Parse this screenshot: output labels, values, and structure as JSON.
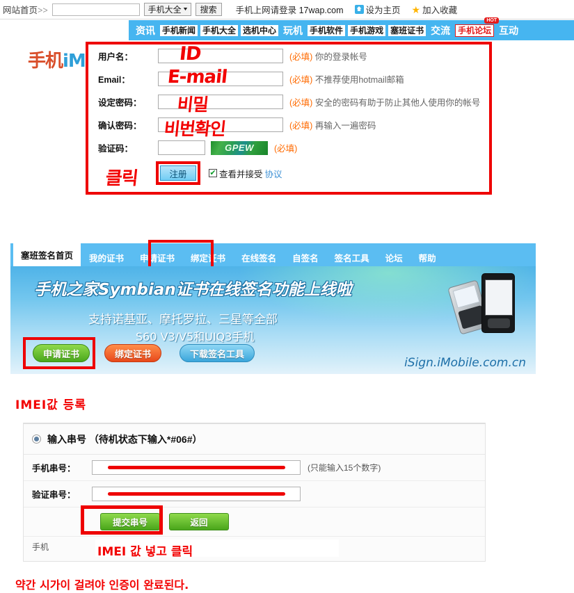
{
  "topbar": {
    "home_link": "网站首页",
    "home_gt": ">>",
    "search_value": "",
    "search_placeholder": "",
    "category_label": "手机大全",
    "search_button": "搜索",
    "tip": "手机上网请登录",
    "tip_domain": "17wap.com",
    "set_home": "设为主页",
    "add_fav": "加入收藏"
  },
  "nav": {
    "logo_text_red": "手机",
    "logo_text_blue": "iMobile",
    "groups": [
      {
        "head": "资讯",
        "chips": [
          "手机新闻",
          "手机大全",
          "选机中心"
        ]
      },
      {
        "head": "玩机",
        "chips": [
          "手机软件",
          "手机游戏",
          "塞班证书"
        ]
      },
      {
        "head": "交流",
        "chips": [
          "手机论坛"
        ]
      },
      {
        "head": "互动",
        "chips": []
      }
    ],
    "hot_badge": "HOT"
  },
  "register_form": {
    "rows": [
      {
        "label": "用户名：",
        "value": "",
        "req": "(必填)",
        "hint": "你的登录帐号",
        "hand": "ID"
      },
      {
        "label": "Email：",
        "value": "",
        "req": "(必填)",
        "hint": "不推荐使用hotmail邮箱",
        "hand": "E-mail"
      },
      {
        "label": "设定密码：",
        "value": "",
        "req": "(必填)",
        "hint": "安全的密码有助于防止其他人使用你的帐号",
        "hand": "비밀"
      },
      {
        "label": "确认密码：",
        "value": "",
        "req": "(必填)",
        "hint": "再输入一遍密码",
        "hand": "비번확인"
      }
    ],
    "captcha_label": "验证码：",
    "captcha_value": "",
    "captcha_text": "GPEW",
    "captcha_req": "(必填)",
    "submit_label": "注册",
    "agree_text": "查看并接受",
    "agree_link": "协议",
    "hand_click": "클릭"
  },
  "sign_page": {
    "tabs": [
      {
        "label": "塞班签名首页",
        "active": true
      },
      {
        "label": "我的证书",
        "active": false
      },
      {
        "label": "申请证书",
        "active": false
      },
      {
        "label": "绑定证书",
        "active": false
      },
      {
        "label": "在线签名",
        "active": false
      },
      {
        "label": "自签名",
        "active": false
      },
      {
        "label": "签名工具",
        "active": false
      },
      {
        "label": "论坛",
        "active": false
      },
      {
        "label": "帮助",
        "active": false
      }
    ],
    "banner": {
      "title": "手机之家Symbian证书在线签名功能上线啦",
      "line2": "支持诺基亚、摩托罗拉、三星等全部",
      "line3": "S60  V3/V5和UIQ3手机",
      "pills": [
        "申请证书",
        "绑定证书",
        "下载签名工具"
      ],
      "site": "iSign.iMobile.com.cn"
    }
  },
  "imei_section": {
    "title_hand": "IMEI값 등록",
    "radio_label": "输入串号  （待机状态下输入*#06#）",
    "rows": [
      {
        "label": "手机串号：",
        "value": "",
        "note": "(只能输入15个数字)"
      },
      {
        "label": "验证串号：",
        "value": "",
        "note": ""
      }
    ],
    "submit_button": "提交串号",
    "back_button": "返回",
    "footer_note": "手机",
    "hand_note": "IMEI 값 넣고 클릭"
  },
  "bottom_note": "약간 시가이 걸려야 인증이 완료된다.",
  "colors": {
    "annotation_red": "#f20000",
    "nav_blue": "#46b5f0",
    "tab_blue": "#5bbdf2",
    "required_orange": "#ff6a00",
    "green_button": "#49a61b"
  }
}
